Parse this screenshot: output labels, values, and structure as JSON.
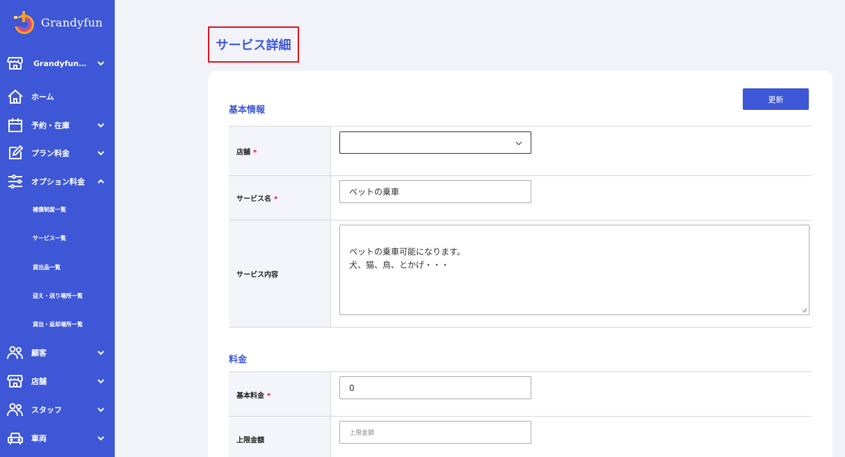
{
  "brand": {
    "name": "Grandyfun",
    "accent": "#3e57d6"
  },
  "sidebar": {
    "store_switcher": {
      "label": "Grandyfun…",
      "icon": "storefront-icon"
    },
    "items": [
      {
        "label": "ホーム",
        "icon": "home-icon"
      },
      {
        "label": "予約・在庫",
        "icon": "calendar-icon"
      },
      {
        "label": "プラン料金",
        "icon": "edit-icon"
      },
      {
        "label": "オプション料金",
        "icon": "sliders-icon"
      },
      {
        "label": "顧客",
        "icon": "users-icon"
      },
      {
        "label": "店舗",
        "icon": "storefront-icon"
      },
      {
        "label": "スタッフ",
        "icon": "users-icon"
      },
      {
        "label": "車両",
        "icon": "car-icon"
      }
    ],
    "subitems": [
      {
        "label": "補償制度一覧"
      },
      {
        "label": "サービス一覧"
      },
      {
        "label": "貸出品一覧"
      },
      {
        "label": "迎え・送り場所一覧"
      },
      {
        "label": "貸出・返却場所一覧"
      }
    ]
  },
  "main": {
    "page_title": "サービス詳細",
    "update_button": "更新",
    "basic_section": {
      "title": "基本情報",
      "store_label": "店舗",
      "service_name_label": "サービス名",
      "service_name_value": "ペットの乗車",
      "service_content_label": "サービス内容",
      "service_content_value": "ペットの乗車可能になります。\n犬、猫、鳥、とかげ・・・"
    },
    "price_section": {
      "title": "料金",
      "base_price_label": "基本料金",
      "base_price_value": "0",
      "max_amount_label": "上限金額",
      "max_amount_placeholder": "上限金額"
    },
    "required_mark": "*"
  }
}
